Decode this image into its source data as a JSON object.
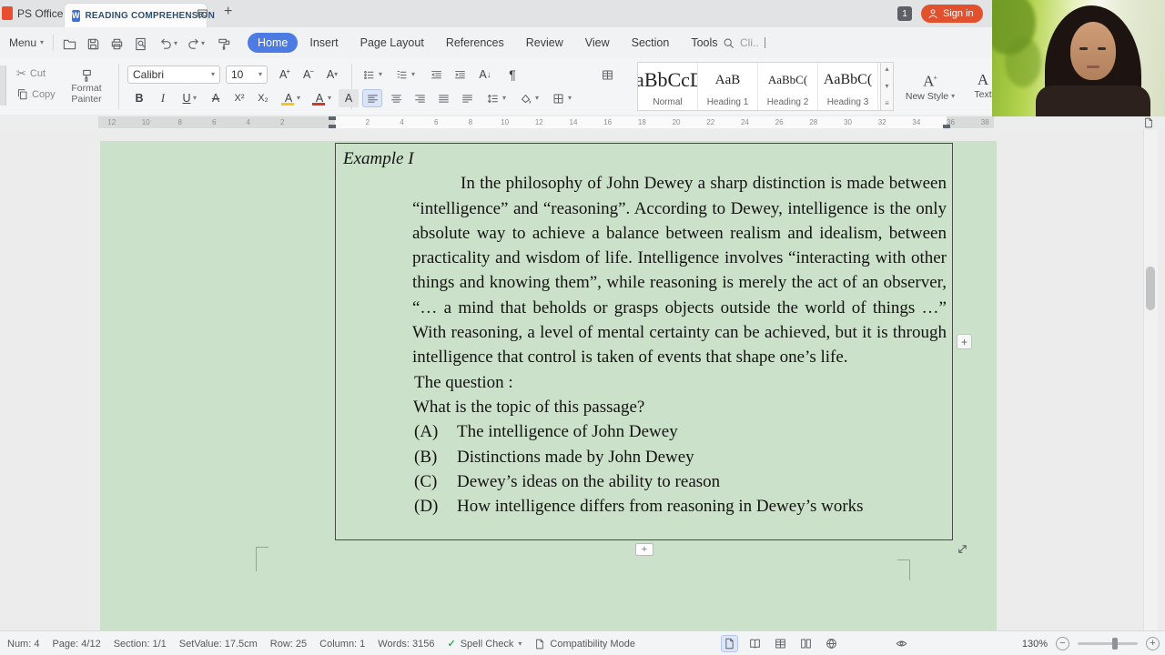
{
  "window": {
    "app_label": "PS Office",
    "doc_icon_letter": "W",
    "doc_tab": "READING COMPREHENSION",
    "new_tab_icon": "+",
    "notification_badge": "1",
    "sign_in_label": "Sign in"
  },
  "menubar": {
    "menu_label": "Menu",
    "search_text": "Cli..",
    "tabs": [
      {
        "label": "Home",
        "active": true
      },
      {
        "label": "Insert"
      },
      {
        "label": "Page Layout"
      },
      {
        "label": "References"
      },
      {
        "label": "Review"
      },
      {
        "label": "View"
      },
      {
        "label": "Section"
      },
      {
        "label": "Tools"
      }
    ]
  },
  "ribbon": {
    "clipboard": {
      "cut_label": "Cut",
      "copy_label": "Copy",
      "format_painter_line1": "Format",
      "format_painter_line2": "Painter"
    },
    "font_name": "Calibri",
    "font_size": "10",
    "fmt": {
      "grow": "A",
      "shrink": "A",
      "clear": "A",
      "bold": "B",
      "italic": "I",
      "underline": "U",
      "strike": "A",
      "superscript": "X²",
      "subscript": "X₂",
      "highlight": "A",
      "font_color": "A",
      "shading": "A",
      "sort": "A"
    },
    "styles": [
      {
        "preview": "AaBbCcDd",
        "label": "Normal"
      },
      {
        "preview": "AaB",
        "label": "Heading 1"
      },
      {
        "preview": "AaBbC(",
        "label": "Heading 2"
      },
      {
        "preview": "AaBbC(",
        "label": "Heading 3"
      }
    ],
    "new_style_label": "New Style",
    "text_tool_label": "Text"
  },
  "ruler": {
    "left_numbers": [
      "12",
      "10",
      "8",
      "6",
      "4",
      "2"
    ],
    "right_numbers": [
      "2",
      "4",
      "6",
      "8",
      "10",
      "12",
      "14",
      "16",
      "18",
      "20",
      "22",
      "24",
      "26",
      "28",
      "30",
      "32",
      "34",
      "36",
      "38"
    ]
  },
  "document": {
    "heading": "Example I",
    "paragraph": "In the philosophy of John Dewey a sharp distinction is made between “intelligence” and “reasoning”. According to Dewey, intelligence is the only absolute way to achieve a balance between realism and idealism, between practicality and wisdom of life. Intelligence involves “interacting with other things and knowing them”, while reasoning is merely the act of an observer, “… a mind that beholds or grasps objects outside the world of things …” With reasoning, a level of mental certainty can be achieved, but it is through intelligence that control is taken of events that shape one’s life.",
    "question_label": "The question :",
    "question_text": "What is the topic of this passage?",
    "options": [
      {
        "letter": "(A)",
        "text": "The intelligence of John Dewey"
      },
      {
        "letter": "(B)",
        "text": "Distinctions made by John Dewey"
      },
      {
        "letter": "(C)",
        "text": "Dewey’s ideas on the ability to reason"
      },
      {
        "letter": "(D)",
        "text": "How intelligence differs from reasoning in Dewey’s works"
      }
    ]
  },
  "statusbar": {
    "items": [
      "Num: 4",
      "Page: 4/12",
      "Section: 1/1",
      "SetValue: 17.5cm",
      "Row: 25",
      "Column: 1",
      "Words: 3156"
    ],
    "spell_check_label": "Spell Check",
    "compatibility_label": "Compatibility Mode",
    "zoom_level": "130%"
  },
  "icons": {
    "caret": "▾",
    "up_arrow": "▴",
    "plus": "+",
    "minus": "−",
    "pilcrow": "¶",
    "scissors": "✂",
    "check": "✓",
    "down_arrow": "↓",
    "more": "≡"
  },
  "colors": {
    "accent_blue": "#4c7be4",
    "page_green": "#cce1c9",
    "sign_in_orange": "#e2512e",
    "doc_tab_text": "#31506e"
  }
}
